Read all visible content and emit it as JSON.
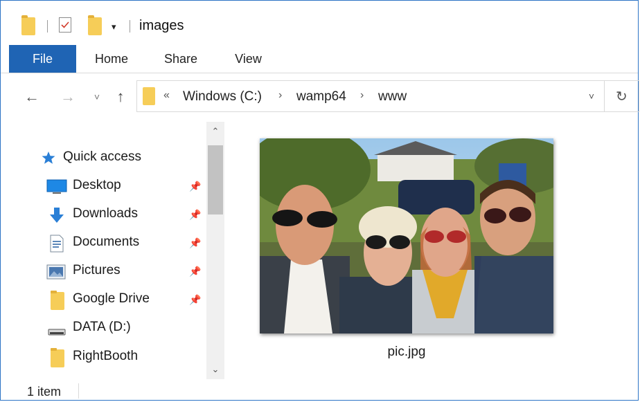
{
  "window": {
    "title": "images"
  },
  "ribbon": {
    "tabs": [
      "File",
      "Home",
      "Share",
      "View"
    ],
    "active_tab": "File",
    "accent_color": "#1f64b4"
  },
  "nav": {
    "breadcrumb_overflow": "«",
    "breadcrumbs": [
      "Windows (C:)",
      "wamp64",
      "www"
    ],
    "separator": "›",
    "icons": {
      "back": "arrow-left-icon",
      "forward": "arrow-right-icon",
      "recent": "chevron-down-icon",
      "up": "arrow-up-icon",
      "refresh": "refresh-icon"
    }
  },
  "sidebar": {
    "items": [
      {
        "label": "Quick access",
        "icon": "star-icon",
        "pinned": false
      },
      {
        "label": "Desktop",
        "icon": "desktop-icon",
        "pinned": true
      },
      {
        "label": "Downloads",
        "icon": "download-icon",
        "pinned": true
      },
      {
        "label": "Documents",
        "icon": "documents-icon",
        "pinned": true
      },
      {
        "label": "Pictures",
        "icon": "pictures-icon",
        "pinned": true
      },
      {
        "label": "Google Drive",
        "icon": "folder-icon",
        "pinned": true
      },
      {
        "label": "DATA (D:)",
        "icon": "drive-icon",
        "pinned": false
      },
      {
        "label": "RightBooth",
        "icon": "folder-icon",
        "pinned": false
      }
    ]
  },
  "files": [
    {
      "name": "pic.jpg",
      "thumbnail": "group-selfie-photo"
    }
  ],
  "status": {
    "count_text": "1 item"
  }
}
